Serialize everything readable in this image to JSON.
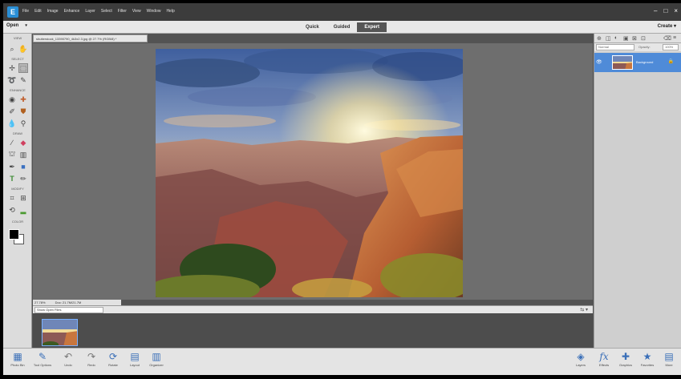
{
  "menubar": {
    "logo": "E",
    "items": [
      "File",
      "Edit",
      "Image",
      "Enhance",
      "Layer",
      "Select",
      "Filter",
      "View",
      "Window",
      "Help"
    ],
    "controls": [
      "–",
      "□",
      "×"
    ]
  },
  "modebar": {
    "open_label": "Open",
    "tabs": [
      {
        "label": "Quick"
      },
      {
        "label": "Guided"
      },
      {
        "label": "Expert"
      }
    ],
    "active_tab": "Expert",
    "create_label": "Create"
  },
  "toolbox": {
    "sections": [
      "VIEW",
      "SELECT",
      "ENHANCE",
      "DRAW",
      "MODIFY",
      "COLOR"
    ],
    "foreground_color": "#000000",
    "background_color": "#ffffff"
  },
  "document": {
    "tab_title": "shutterstock_13390790_4k3x2.3.jpg @ 27.7% (RGB/8) *",
    "zoom": "27.78%",
    "doc_size": "Doc: 21.7M/21.7M"
  },
  "photo_bin": {
    "dropdown": "Show Open Files"
  },
  "layers_panel": {
    "blend_mode": "Normal",
    "opacity_label": "Opacity:",
    "opacity_value": "100%",
    "layer_name": "Background"
  },
  "taskbar": {
    "left": [
      {
        "icon": "photo-bin-icon",
        "label": "Photo Bin"
      },
      {
        "icon": "tool-options-icon",
        "label": "Tool Options"
      },
      {
        "icon": "undo-icon",
        "label": "Undo"
      },
      {
        "icon": "redo-icon",
        "label": "Redo"
      },
      {
        "icon": "rotate-icon",
        "label": "Rotate"
      },
      {
        "icon": "layout-icon",
        "label": "Layout"
      },
      {
        "icon": "organizer-icon",
        "label": "Organizer"
      }
    ],
    "right": [
      {
        "icon": "layers-icon",
        "label": "Layers"
      },
      {
        "icon": "effects-icon",
        "label": "Effects"
      },
      {
        "icon": "graphics-icon",
        "label": "Graphics"
      },
      {
        "icon": "favorites-icon",
        "label": "Favorites"
      },
      {
        "icon": "more-icon",
        "label": "More"
      }
    ]
  }
}
